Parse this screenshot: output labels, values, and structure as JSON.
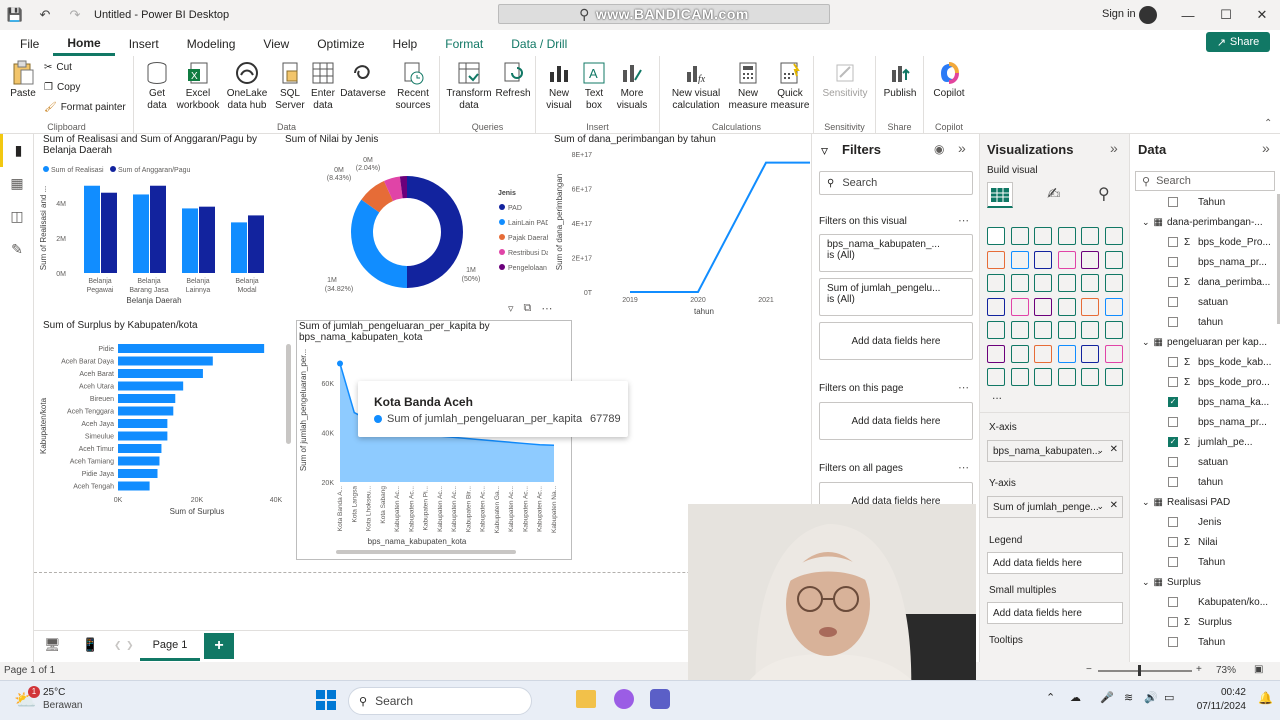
{
  "window": {
    "title": "Untitled - Power BI Desktop",
    "signin": "Sign in"
  },
  "watermark": "www.BANDICAM.com",
  "menu": {
    "items": [
      "File",
      "Home",
      "Insert",
      "Modeling",
      "View",
      "Optimize",
      "Help",
      "Format",
      "Data / Drill"
    ],
    "active": "Home",
    "share": "Share"
  },
  "ribbon": {
    "clipboard": {
      "paste": "Paste",
      "cut": "Cut",
      "copy": "Copy",
      "format_painter": "Format painter",
      "label": "Clipboard"
    },
    "data": {
      "get": "Get data",
      "excel": "Excel workbook",
      "onelake": "OneLake data hub",
      "sql": "SQL Server",
      "enter": "Enter data",
      "dataverse": "Dataverse",
      "recent": "Recent sources",
      "label": "Data"
    },
    "queries": {
      "transform": "Transform data",
      "refresh": "Refresh",
      "label": "Queries"
    },
    "insert": {
      "new_visual": "New visual",
      "textbox": "Text box",
      "more": "More visuals",
      "label": "Insert"
    },
    "calc": {
      "new_visual_calc": "New visual calculation",
      "new_measure": "New measure",
      "quick_measure": "Quick measure",
      "label": "Calculations"
    },
    "sensitivity": {
      "btn": "Sensitivity",
      "label": "Sensitivity"
    },
    "share": {
      "publish": "Publish",
      "label": "Share"
    },
    "copilot": {
      "btn": "Copilot",
      "label": "Copilot"
    }
  },
  "charts": {
    "bar1": {
      "title": "Sum of Realisasi and Sum of Anggaran/Pagu by Belanja Daerah",
      "legend": [
        "Sum of Realisasi",
        "Sum of Anggaran/Pagu"
      ],
      "ylabel": "Sum of Realisasi and ...",
      "xlabel": "Belanja Daerah",
      "yticks": [
        "4M",
        "2M",
        "0M"
      ],
      "categories": [
        "Belanja Pegawai",
        "Belanja Barang Jasa",
        "Belanja Lainnya",
        "Belanja Modal"
      ]
    },
    "donut": {
      "title": "Sum of Nilai by Jenis",
      "legend_title": "Jenis",
      "legend": [
        "PAD",
        "LainLain PAD ya...",
        "Pajak Daerah",
        "Restribusi Daerah",
        "Pengelolaan Ke..."
      ],
      "labels": [
        "0M",
        "(2.04%)",
        "0M",
        "(8.43%)",
        "1M",
        "(34.82%)",
        "1M",
        "(50%)"
      ]
    },
    "line": {
      "title": "Sum of dana_perimbangan by tahun",
      "ylabel": "Sum of dana_perimbangan",
      "xlabel": "tahun",
      "yticks": [
        "8E+17",
        "6E+17",
        "4E+17",
        "2E+17",
        "0T"
      ],
      "xticks": [
        "2019",
        "2020",
        "2021",
        "2022"
      ]
    },
    "hbar": {
      "title": "Sum of Surplus by Kabupaten/kota",
      "ylabel": "Kabupaten/kota",
      "xlabel": "Sum of Surplus",
      "xticks": [
        "0K",
        "20K",
        "40K"
      ],
      "categories": [
        "Pidie",
        "Aceh Barat Daya",
        "Aceh Barat",
        "Aceh Utara",
        "Bireuen",
        "Aceh Tenggara",
        "Aceh Jaya",
        "Simeulue",
        "Aceh Timur",
        "Aceh Tamiang",
        "Pidie Jaya",
        "Aceh Tengah"
      ]
    },
    "area": {
      "title": "Sum of jumlah_pengeluaran_per_kapita by bps_nama_kabupaten_kota",
      "ylabel": "Sum of jumlah_pengeluaran_per...",
      "xlabel": "bps_nama_kabupaten_kota",
      "yticks": [
        "60K",
        "40K",
        "20K"
      ],
      "xcats": [
        "Kota Banda A...",
        "Kota Langsa",
        "Kota Lhokseu...",
        "Kota Sabang",
        "Kabupaten Ac...",
        "Kabupaten Ac...",
        "Kabupaten Pi...",
        "Kabupaten Ac...",
        "Kabupaten Ac...",
        "Kabupaten Bir...",
        "Kabupaten Ac...",
        "Kabupaten Ga...",
        "Kabupaten Ac...",
        "Kabupaten Ac...",
        "Kabupaten Ac...",
        "Kabupaten Na..."
      ]
    },
    "tooltip": {
      "title": "Kota Banda Aceh",
      "measure": "Sum of jumlah_pengeluaran_per_kapita",
      "value": "67789"
    }
  },
  "chart_data": [
    {
      "type": "bar",
      "title": "Sum of Realisasi and Sum of Anggaran/Pagu by Belanja Daerah",
      "categories": [
        "Belanja Pegawai",
        "Belanja Barang Jasa",
        "Belanja Lainnya",
        "Belanja Modal"
      ],
      "series": [
        {
          "name": "Sum of Realisasi",
          "values": [
            5.0,
            4.5,
            3.7,
            2.9
          ]
        },
        {
          "name": "Sum of Anggaran/Pagu",
          "values": [
            4.6,
            5.0,
            3.8,
            3.3
          ]
        }
      ],
      "ylim": [
        0,
        5.5
      ],
      "unit": "M",
      "color": [
        "#118dff",
        "#12239e"
      ]
    },
    {
      "type": "pie",
      "title": "Sum of Nilai by Jenis",
      "categories": [
        "PAD",
        "LainLain PAD ya...",
        "Pajak Daerah",
        "Restribusi Daerah",
        "Pengelolaan Ke..."
      ],
      "values": [
        50,
        34.82,
        8.43,
        4.71,
        2.04
      ],
      "colors": [
        "#12239e",
        "#118dff",
        "#e66c37",
        "#e044a7",
        "#6b007b"
      ]
    },
    {
      "type": "line",
      "title": "Sum of dana_perimbangan by tahun",
      "x": [
        2019,
        2020,
        2021,
        2022
      ],
      "values": [
        0,
        0,
        7.5e+17,
        7.5e+17
      ],
      "ylim": [
        0,
        8e+17
      ]
    },
    {
      "type": "bar",
      "title": "Sum of Surplus by Kabupaten/kota",
      "categories": [
        "Pidie",
        "Aceh Barat Daya",
        "Aceh Barat",
        "Aceh Utara",
        "Bireuen",
        "Aceh Tenggara",
        "Aceh Jaya",
        "Simeulue",
        "Aceh Timur",
        "Aceh Tamiang",
        "Pidie Jaya",
        "Aceh Tengah"
      ],
      "values": [
        37000,
        24000,
        21500,
        16500,
        14500,
        14000,
        12500,
        12500,
        11000,
        10500,
        10000,
        8000
      ],
      "xlim": [
        0,
        40000
      ]
    },
    {
      "type": "area",
      "title": "Sum of jumlah_pengeluaran_per_kapita by bps_nama_kabupaten_kota",
      "values": [
        67789,
        48000,
        45000,
        43000,
        41000,
        40000,
        39000,
        38500,
        38000,
        37500,
        37000,
        36500,
        36000,
        35500,
        35000,
        34800
      ],
      "ylim": [
        20000,
        70000
      ]
    }
  ],
  "filters": {
    "title": "Filters",
    "search": "Search",
    "on_visual": "Filters on this visual",
    "card1_field": "bps_nama_kabupaten_...",
    "card1_val": "is (All)",
    "card2_field": "Sum of jumlah_pengelu...",
    "card2_val": "is (All)",
    "add": "Add data fields here",
    "on_page": "Filters on this page",
    "on_all": "Filters on all pages"
  },
  "viz": {
    "title": "Visualizations",
    "build": "Build visual",
    "xaxis": "X-axis",
    "xaxis_field": "bps_nama_kabupaten...",
    "yaxis": "Y-axis",
    "yaxis_field": "Sum of jumlah_penge...",
    "legend": "Legend",
    "legend_add": "Add data fields here",
    "small": "Small multiples",
    "small_add": "Add data fields here",
    "tooltips": "Tooltips",
    "more": "..."
  },
  "data": {
    "title": "Data",
    "search": "Search",
    "rows": [
      {
        "t": "field",
        "l": "Tahun",
        "c": false,
        "s": false
      },
      {
        "t": "table",
        "l": "dana-perimbangan-..."
      },
      {
        "t": "field",
        "l": "bps_kode_Pro...",
        "c": false,
        "s": true
      },
      {
        "t": "field",
        "l": "bps_nama_pr...",
        "c": false,
        "s": false
      },
      {
        "t": "field",
        "l": "dana_perimba...",
        "c": false,
        "s": true
      },
      {
        "t": "field",
        "l": "satuan",
        "c": false,
        "s": false
      },
      {
        "t": "field",
        "l": "tahun",
        "c": false,
        "s": false
      },
      {
        "t": "table",
        "l": "pengeluaran per kap..."
      },
      {
        "t": "field",
        "l": "bps_kode_kab...",
        "c": false,
        "s": true
      },
      {
        "t": "field",
        "l": "bps_kode_pro...",
        "c": false,
        "s": true
      },
      {
        "t": "field",
        "l": "bps_nama_ka...",
        "c": true,
        "s": false
      },
      {
        "t": "field",
        "l": "bps_nama_pr...",
        "c": false,
        "s": false
      },
      {
        "t": "field",
        "l": "jumlah_pe...",
        "c": true,
        "s": true
      },
      {
        "t": "field",
        "l": "satuan",
        "c": false,
        "s": false
      },
      {
        "t": "field",
        "l": "tahun",
        "c": false,
        "s": false
      },
      {
        "t": "table",
        "l": "Realisasi PAD"
      },
      {
        "t": "field",
        "l": "Jenis",
        "c": false,
        "s": false
      },
      {
        "t": "field",
        "l": "Nilai",
        "c": false,
        "s": true
      },
      {
        "t": "field",
        "l": "Tahun",
        "c": false,
        "s": false
      },
      {
        "t": "table",
        "l": "Surplus"
      },
      {
        "t": "field",
        "l": "Kabupaten/ko...",
        "c": false,
        "s": false
      },
      {
        "t": "field",
        "l": "Surplus",
        "c": false,
        "s": true
      },
      {
        "t": "field",
        "l": "Tahun",
        "c": false,
        "s": false
      }
    ]
  },
  "pages": {
    "tab": "Page 1",
    "add": "+",
    "status": "Page 1 of 1",
    "zoom": "73%"
  },
  "taskbar": {
    "temp": "25°C",
    "weather": "Berawan",
    "badge": "1",
    "search": "Search",
    "time": "00:42",
    "date": "07/11/2024"
  }
}
